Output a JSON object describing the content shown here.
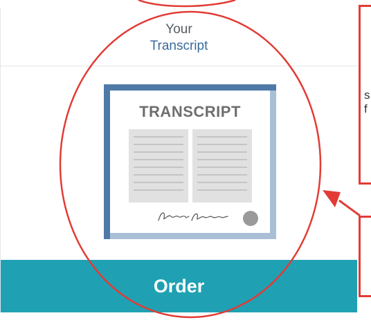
{
  "card": {
    "title_line1": "Your",
    "title_line2": "Transcript",
    "order_label": "Order"
  },
  "document": {
    "heading": "TRANSCRIPT",
    "signature_text": "Random Person",
    "seal_icon": "seal-icon"
  },
  "callout": {
    "fragment_1": "s",
    "fragment_2": "f"
  },
  "colors": {
    "accent": "#1fa1b3",
    "annotation_red": "#e23b35",
    "frame_blue": "#4f7aa8",
    "link_blue": "#3a6b9a"
  }
}
